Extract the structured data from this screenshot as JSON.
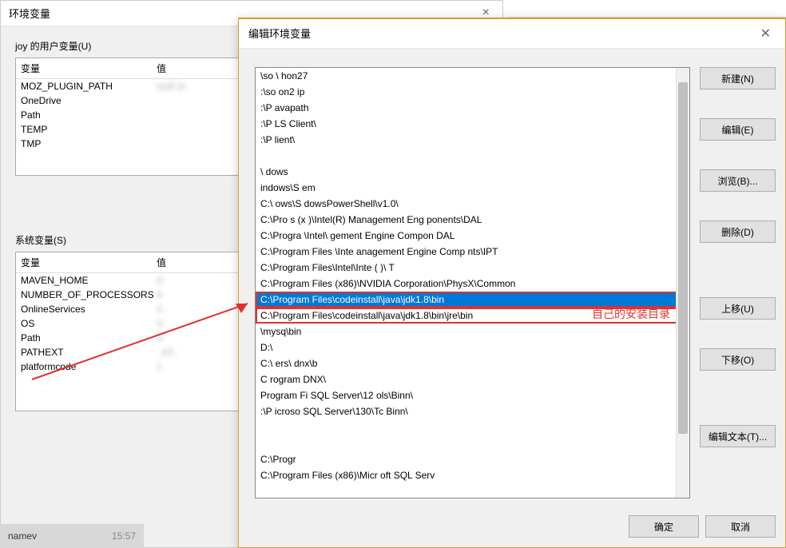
{
  "dialog1": {
    "title": "环境变量",
    "userVarsLabel": "joy 的用户变量(U)",
    "sysVarsLabel": "系统变量(S)",
    "headers": {
      "name": "变量",
      "value": "值"
    },
    "userVars": [
      {
        "name": "MOZ_PLUGIN_PATH",
        "value": "\\soft        ol"
      },
      {
        "name": "OneDrive",
        "value": ""
      },
      {
        "name": "Path",
        "value": ""
      },
      {
        "name": "TEMP",
        "value": ""
      },
      {
        "name": "TMP",
        "value": ""
      }
    ],
    "sysVars": [
      {
        "name": "MAVEN_HOME",
        "value": "D"
      },
      {
        "name": "NUMBER_OF_PROCESSORS",
        "value": "8"
      },
      {
        "name": "OnlineServices",
        "value": "C"
      },
      {
        "name": "OS",
        "value": "V"
      },
      {
        "name": "Path",
        "value": "D"
      },
      {
        "name": "PATHEXT",
        "value": ".                      AT;."
      },
      {
        "name": "platformcode",
        "value": "1"
      }
    ]
  },
  "dialog2": {
    "title": "编辑环境变量",
    "items": [
      "    \\so      \\ hon27",
      "  :\\so          on2      ip",
      "  :\\P                           avapath",
      "  :\\P                           LS Client\\",
      "  :\\P                           lient\\",
      "",
      "  \\  dows",
      "    indows\\S            em",
      "C:\\    ows\\S            dowsPowerShell\\v1.0\\",
      "C:\\Pro          s  (x     )\\Intel(R) Management Eng          ponents\\DAL",
      "C:\\Progra              \\Intel\\                 gement Engine Compon      DAL",
      "C:\\Program Files                 \\Inte    anagement Engine Comp       nts\\IPT",
      "C:\\Program Files\\Intel\\Inte (  )\\                                         T",
      "C:\\Program Files (x86)\\NVIDIA Corporation\\PhysX\\Common",
      "C:\\Program Files\\codeinstall\\java\\jdk1.8\\bin",
      "C:\\Program Files\\codeinstall\\java\\jdk1.8\\bin\\jre\\bin",
      "                      \\mysq\\bin",
      "D:\\",
      "C:\\    ers\\       dnx\\b",
      "C   rogram                   DNX\\",
      "    Program Fi              SQL Server\\12     ols\\Binn\\",
      "  :\\P                  icroso   SQL Server\\130\\Tc     Binn\\",
      "",
      "",
      "C:\\Progr",
      "C:\\Program Files (x86)\\Micr    oft SQL Serv"
    ],
    "selectedIndex": 14,
    "boxedIndices": [
      14,
      15
    ],
    "annotation": "自己的安装目录",
    "buttons": {
      "new": "新建(N)",
      "edit": "编辑(E)",
      "browse": "浏览(B)...",
      "delete": "删除(D)",
      "moveUp": "上移(U)",
      "moveDown": "下移(O)",
      "editText": "编辑文本(T)...",
      "ok": "确定",
      "cancel": "取消"
    }
  },
  "taskbar": {
    "name": "namev",
    "time": "15:57"
  }
}
